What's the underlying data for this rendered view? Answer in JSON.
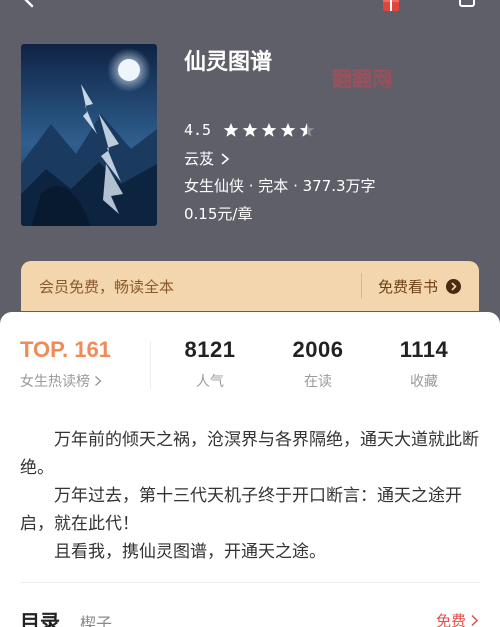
{
  "book": {
    "title": "仙灵图谱",
    "watermark": "翻翻网",
    "rating": "4.5",
    "stars": [
      1,
      1,
      1,
      1,
      0.5
    ],
    "author": "云芨",
    "meta": "女生仙侠 · 完本 · 377.3万字",
    "price": "0.15元/章",
    "cover_colors": [
      "#1c3d6b",
      "#3b6f9e",
      "#9fb8d4"
    ]
  },
  "vip": {
    "text": "会员免费，畅读全本",
    "action": "免费看书"
  },
  "stats": {
    "rank_value": "TOP. 161",
    "rank_label": "女生热读榜",
    "popularity_value": "8121",
    "popularity_label": "人气",
    "reading_value": "2006",
    "reading_label": "在读",
    "collect_value": "1114",
    "collect_label": "收藏"
  },
  "description": [
    "万年前的倾天之祸，沧溟界与各界隔绝，通天大道就此断绝。",
    "万年过去，第十三代天机子终于开口断言：通天之途开启，就在此代！",
    "且看我，携仙灵图谱，开通天之途。"
  ],
  "toc": {
    "title": "目录",
    "subtitle": "楔子",
    "free": "免费"
  },
  "colors": {
    "header_bg": "#5f5f69",
    "accent": "#f08a57",
    "vip_bg": "#f3d6ad",
    "free_red": "#e5504a"
  }
}
